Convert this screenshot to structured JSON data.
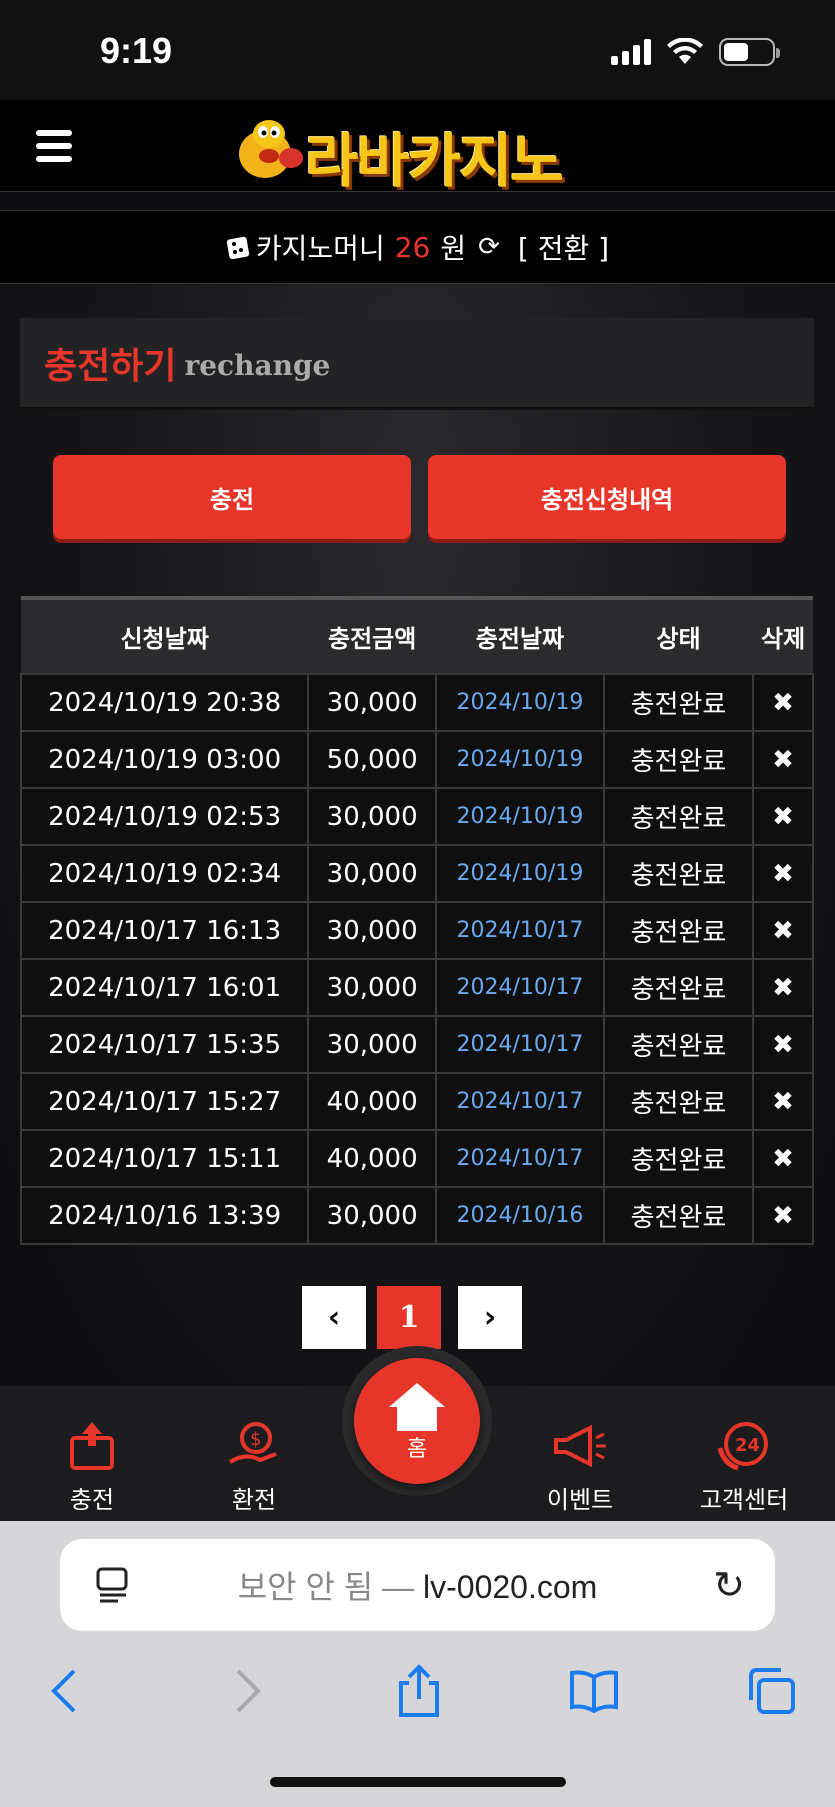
{
  "status_bar": {
    "time": "9:19"
  },
  "header": {
    "logo_text": "라바카지노"
  },
  "money_bar": {
    "label": "카지노머니",
    "amount": "26",
    "unit": "원",
    "swap_label": "[ 전환 ]"
  },
  "title": {
    "ko": "충전하기",
    "en": "rechange"
  },
  "buttons": {
    "charge": "충전",
    "history": "충전신청내역"
  },
  "table": {
    "headers": [
      "신청날짜",
      "충전금액",
      "충전날짜",
      "상태",
      "삭제"
    ],
    "rows": [
      {
        "req": "2024/10/19 20:38",
        "amount": "30,000",
        "date": "2024/10/19",
        "status": "충전완료",
        "del": "✖"
      },
      {
        "req": "2024/10/19 03:00",
        "amount": "50,000",
        "date": "2024/10/19",
        "status": "충전완료",
        "del": "✖"
      },
      {
        "req": "2024/10/19 02:53",
        "amount": "30,000",
        "date": "2024/10/19",
        "status": "충전완료",
        "del": "✖"
      },
      {
        "req": "2024/10/19 02:34",
        "amount": "30,000",
        "date": "2024/10/19",
        "status": "충전완료",
        "del": "✖"
      },
      {
        "req": "2024/10/17 16:13",
        "amount": "30,000",
        "date": "2024/10/17",
        "status": "충전완료",
        "del": "✖"
      },
      {
        "req": "2024/10/17 16:01",
        "amount": "30,000",
        "date": "2024/10/17",
        "status": "충전완료",
        "del": "✖"
      },
      {
        "req": "2024/10/17 15:35",
        "amount": "30,000",
        "date": "2024/10/17",
        "status": "충전완료",
        "del": "✖"
      },
      {
        "req": "2024/10/17 15:27",
        "amount": "40,000",
        "date": "2024/10/17",
        "status": "충전완료",
        "del": "✖"
      },
      {
        "req": "2024/10/17 15:11",
        "amount": "40,000",
        "date": "2024/10/17",
        "status": "충전완료",
        "del": "✖"
      },
      {
        "req": "2024/10/16 13:39",
        "amount": "30,000",
        "date": "2024/10/16",
        "status": "충전완료",
        "del": "✖"
      }
    ]
  },
  "pagination": {
    "prev": "‹",
    "current": "1",
    "next": "›"
  },
  "bottom_nav": {
    "charge": "충전",
    "exchange": "환전",
    "home": "홈",
    "event": "이벤트",
    "support": "고객센터"
  },
  "browser": {
    "insecure": "보안 안 됨 —",
    "domain": "lv-0020.com"
  },
  "colors": {
    "accent": "#e8352a",
    "link_date": "#6aa9f0",
    "background": "#0e0e10"
  }
}
